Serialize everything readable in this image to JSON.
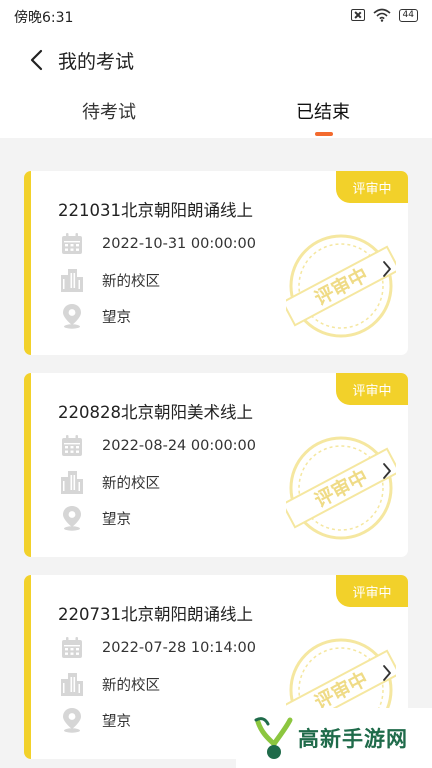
{
  "statusbar": {
    "time": "傍晚6:31",
    "battery": "44"
  },
  "header": {
    "title": "我的考试"
  },
  "tabs": [
    {
      "label": "待考试"
    },
    {
      "label": "已结束"
    }
  ],
  "colors": {
    "accent": "#f2d12a",
    "tab_indicator": "#f36a2e",
    "icon_gray": "#d6d6d6"
  },
  "exams": [
    {
      "name": "221031北京朝阳朗诵线上",
      "datetime": "2022-10-31 00:00:00",
      "campus": "新的校区",
      "location": "望京",
      "status": "评审中",
      "stamp": "评审中"
    },
    {
      "name": "220828北京朝阳美术线上",
      "datetime": "2022-08-24 00:00:00",
      "campus": "新的校区",
      "location": "望京",
      "status": "评审中",
      "stamp": "评审中"
    },
    {
      "name": "220731北京朝阳朗诵线上",
      "datetime": "2022-07-28 10:14:00",
      "campus": "新的校区",
      "location": "望京",
      "status": "评审中",
      "stamp": "评审中"
    }
  ],
  "watermark": {
    "text": "高新手游网"
  }
}
